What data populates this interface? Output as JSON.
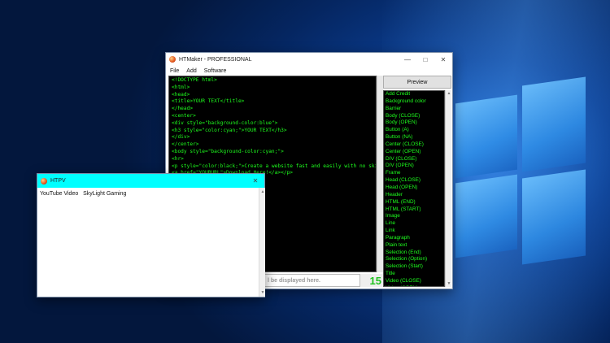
{
  "main_window": {
    "title": "HTMaker - PROFESSIONAL",
    "menu": [
      "File",
      "Add",
      "Software"
    ],
    "code_lines": [
      "<!DOCTYPE html>",
      "<html>",
      "<head>",
      "<title>YOUR TEXT</title>",
      "</head>",
      "<center>",
      "<div style=\"background-color:blue\">",
      "<h3 style=\"color:cyan;\">YOUR TEXT</h3>",
      "</div>",
      "</center>",
      "<body style=\"background-color:cyan;\">",
      "<hr>",
      "<p style=\"color:black;\">Create a website fast and easily with no skill needed!",
      "<a href=\"YOURURL\">Download Here!</a></p>"
    ],
    "preview_label": "Preview",
    "tags": [
      "Add Credit",
      "Background color",
      "Barrier",
      "Body (CLOSE)",
      "Body (OPEN)",
      "Button (A)",
      "Button (NA)",
      "Center (CLOSE)",
      "Center (OPEN)",
      "DIV (CLOSE)",
      "DIV (OPEN)",
      "Frame",
      "Head (CLOSE)",
      "Head (OPEN)",
      "Header",
      "HTML (END)",
      "HTML (START)",
      "Image",
      "Line",
      "Link",
      "Paragraph",
      "Plain text",
      "Selection (End)",
      "Selection (Option)",
      "Selection (Start)",
      "Title",
      "Video (CLOSE)",
      "Video (OPEN)"
    ],
    "bottom_placeholder": "l be displayed here.",
    "counter": "15",
    "accent_text_color": "#1eff1e"
  },
  "htpv_window": {
    "title": "HTPV",
    "content": "YouTube Video   SkyLight Gaming",
    "titlebar_color": "#00ffff"
  }
}
